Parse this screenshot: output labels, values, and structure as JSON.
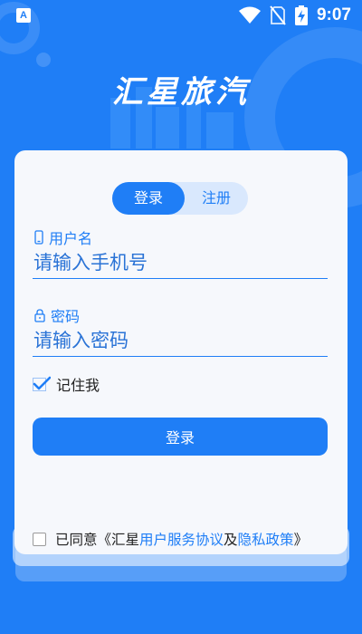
{
  "status_bar": {
    "time": "9:07",
    "notification_icon_letter": "A",
    "icons": [
      "wifi-icon",
      "no-sim-icon",
      "battery-charging-icon"
    ]
  },
  "app": {
    "title": "汇星旅汽"
  },
  "tabs": {
    "login": "登录",
    "register": "注册",
    "active": "login"
  },
  "form": {
    "username": {
      "label": "用户名",
      "placeholder": "请输入手机号",
      "value": ""
    },
    "password": {
      "label": "密码",
      "placeholder": "请输入密码",
      "value": ""
    },
    "remember": {
      "label": "记住我",
      "checked": true
    },
    "submit_label": "登录"
  },
  "agreement": {
    "prefix": "已同意《汇星",
    "terms_link": "用户服务协议",
    "conjunction": "及",
    "privacy_link": "隐私政策",
    "suffix": "》",
    "checked": false
  },
  "colors": {
    "primary": "#1f7ef6",
    "card": "#f6f8fc",
    "tab_track": "#d9e8fd"
  }
}
